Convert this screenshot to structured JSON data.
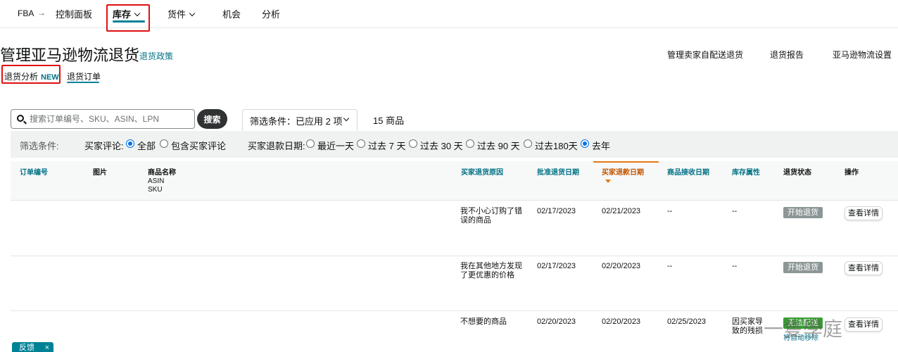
{
  "nav": {
    "fba": "FBA",
    "arrow": "→",
    "dashboard": "控制面板",
    "inventory": "库存",
    "shipments": "货件",
    "opportunities": "机会",
    "analytics": "分析"
  },
  "header": {
    "title": "管理亚马逊物流退货",
    "return_policy": "退货政策",
    "links": [
      "管理卖家自配送退货",
      "退货报告",
      "亚马逊物流设置"
    ]
  },
  "subtabs": {
    "analysis": "退货分析",
    "new_badge": "NEW",
    "orders": "退货订单"
  },
  "search": {
    "placeholder": "搜索订单编号、SKU、ASIN、LPN",
    "button": "搜索"
  },
  "filter": {
    "dropdown_label": "筛选条件：已应用 2 项",
    "item_count": "15 商品",
    "bar_label": "筛选条件:",
    "review_label": "买家评论:",
    "review_options": [
      "全部",
      "包含买家评论"
    ],
    "review_selected": "全部",
    "refund_label": "买家退款日期:",
    "refund_options": [
      "最近一天",
      "过去 7 天",
      "过去 30 天",
      "过去 90 天",
      "过去180天",
      "去年"
    ],
    "refund_selected": "去年"
  },
  "table": {
    "headers": {
      "order_id": "订单编号",
      "image": "图片",
      "product_name": "商品名称",
      "asin": "ASIN",
      "sku": "SKU",
      "reason": "买家退货原因",
      "approved_date": "批准退货日期",
      "refund_date": "买家退款日期",
      "received_date": "商品接收日期",
      "inventory_attr": "库存属性",
      "status": "退货状态",
      "action": "操作"
    },
    "rows": [
      {
        "reason": "我不小心订购了错误的商品",
        "approved": "02/17/2023",
        "refund": "02/21/2023",
        "received": "--",
        "attr": "--",
        "status": "开始退货",
        "action": "查看详情"
      },
      {
        "reason": "我在其他地方发现了更优惠的价格",
        "approved": "02/17/2023",
        "refund": "02/20/2023",
        "received": "--",
        "attr": "--",
        "status": "开始退货",
        "action": "查看详情"
      },
      {
        "reason": "不想要的商品",
        "approved": "02/20/2023",
        "refund": "02/20/2023",
        "received": "02/25/2023",
        "attr": "因买家导致的残损",
        "status": "无法配送",
        "status_note": "将自动移除",
        "action": "查看详情"
      }
    ]
  },
  "feedback": {
    "label": "反馈",
    "close": "×"
  },
  "watermark": "一隻學庭",
  "colors": {
    "teal": "#007185",
    "highlight_red": "#e01010",
    "sort_orange": "#e47911",
    "badge_gray": "#8d9696",
    "badge_green": "#3a9b34"
  }
}
